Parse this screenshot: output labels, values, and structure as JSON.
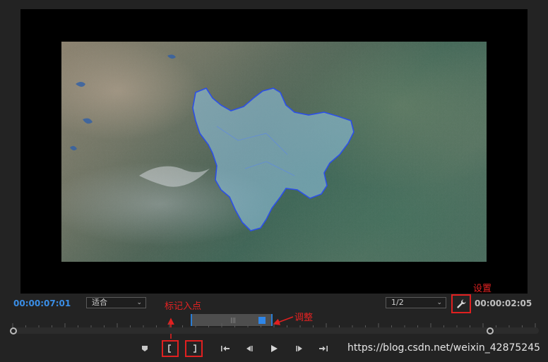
{
  "player": {
    "current_timecode": "00:00:07:01",
    "zoom_value": "适合",
    "resolution_value": "1/2",
    "duration_timecode": "00:00:02:05"
  },
  "annotations": {
    "settings_label": "设置",
    "mark_in_label": "标记入点",
    "adjust_label": "调整"
  },
  "icons": [
    "marker-icon",
    "mark-in-icon",
    "mark-out-icon",
    "go-to-in-icon",
    "step-back-icon",
    "play-icon",
    "step-forward-icon",
    "go-to-out-icon",
    "wrench-icon"
  ],
  "watermark": "https://blog.csdn.net/weixin_42875245",
  "colors": {
    "accent": "#2f86e8",
    "annotation": "#e02020",
    "region_fill": "#8cbfd9",
    "region_stroke": "#2c4fe8"
  }
}
